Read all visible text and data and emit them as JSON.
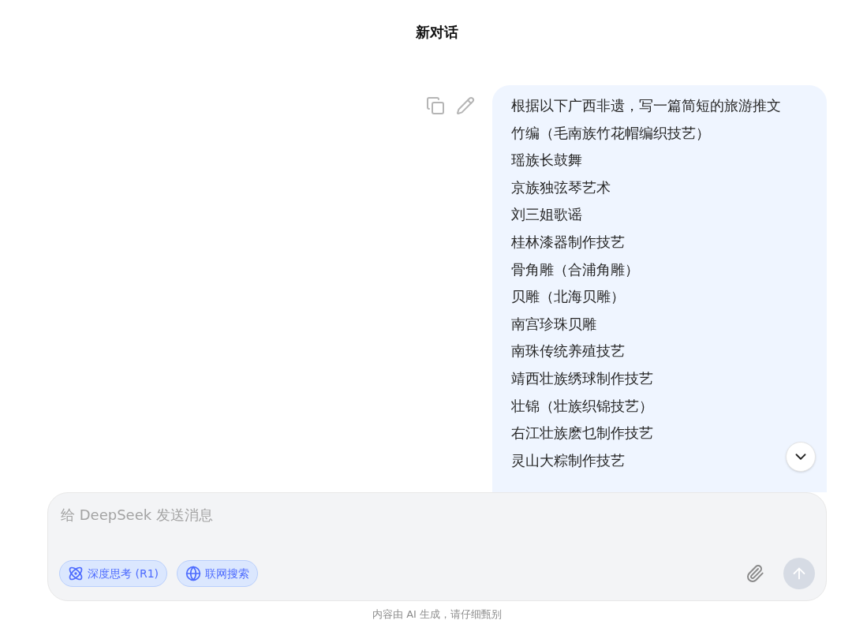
{
  "header": {
    "title": "新对话"
  },
  "message": {
    "lines": [
      "根据以下广西非遗，写一篇简短的旅游推文",
      "竹编（毛南族竹花帽编织技艺）",
      "瑶族长鼓舞",
      "京族独弦琴艺术",
      "刘三姐歌谣",
      "桂林漆器制作技艺",
      "骨角雕（合浦角雕）",
      "贝雕（北海贝雕）",
      "南宫珍珠贝雕",
      "南珠传统养殖技艺",
      "靖西壮族绣球制作技艺",
      "壮锦（壮族织锦技艺）",
      "右江壮族麽乜制作技艺",
      "灵山大粽制作技艺"
    ]
  },
  "composer": {
    "placeholder": "给 DeepSeek 发送消息",
    "toggles": [
      {
        "kind": "deepthink",
        "label": "深度思考 (R1)",
        "selected": true
      },
      {
        "kind": "search",
        "label": "联网搜索",
        "selected": true
      }
    ],
    "send_disabled": true
  },
  "footer": {
    "note": "内容由 AI 生成，请仔细甄别"
  }
}
